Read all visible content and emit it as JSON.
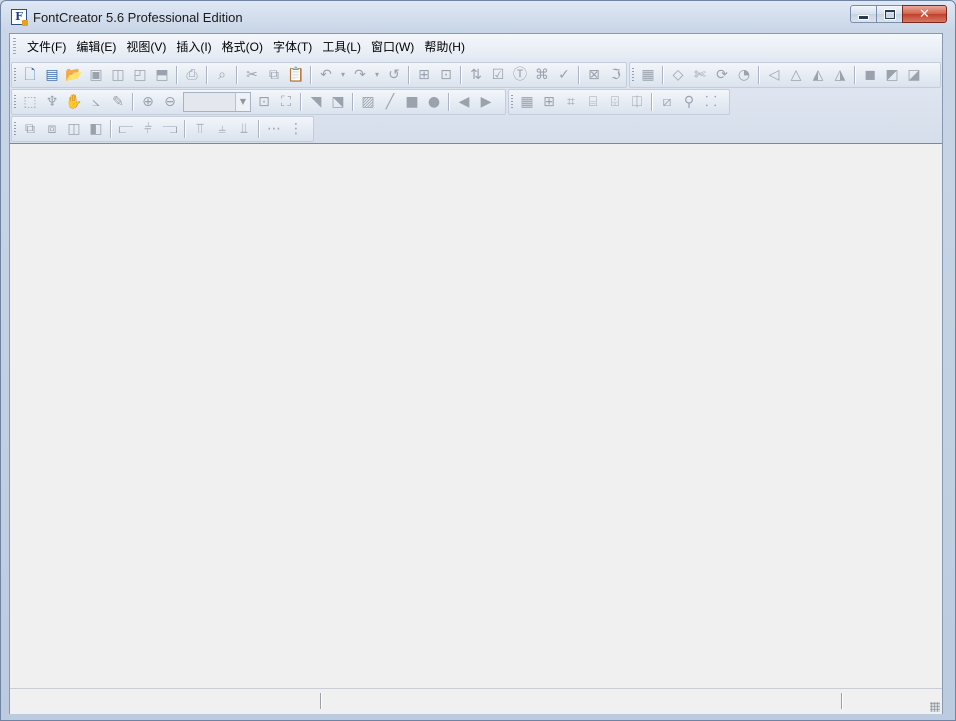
{
  "window": {
    "title": "FontCreator 5.6 Professional Edition",
    "app_icon_letter": "F",
    "close_glyph": "✕"
  },
  "menu": {
    "items": [
      {
        "label": "文件(F)",
        "name": "menu-file"
      },
      {
        "label": "编辑(E)",
        "name": "menu-edit"
      },
      {
        "label": "视图(V)",
        "name": "menu-view"
      },
      {
        "label": "插入(I)",
        "name": "menu-insert"
      },
      {
        "label": "格式(O)",
        "name": "menu-format"
      },
      {
        "label": "字体(T)",
        "name": "menu-font"
      },
      {
        "label": "工具(L)",
        "name": "menu-tools"
      },
      {
        "label": "窗口(W)",
        "name": "menu-window"
      },
      {
        "label": "帮助(H)",
        "name": "menu-help"
      }
    ]
  },
  "toolbar": {
    "zoom_value": "",
    "row1a": [
      {
        "icon": "new-file-icon",
        "glyph": "🗋",
        "active": true
      },
      {
        "icon": "new-from-template-icon",
        "glyph": "▤",
        "active": true
      },
      {
        "icon": "open-folder-icon",
        "glyph": "📂",
        "active": true,
        "folder": true
      },
      {
        "icon": "save-icon",
        "glyph": "▣"
      },
      {
        "icon": "save-all-icon",
        "glyph": "◫"
      },
      {
        "icon": "save-copy-icon",
        "glyph": "◰"
      },
      {
        "icon": "export-icon",
        "glyph": "⬒"
      },
      {
        "sep": true
      },
      {
        "icon": "print-icon",
        "glyph": "⎙"
      },
      {
        "sep": true
      },
      {
        "icon": "find-icon",
        "glyph": "⌕"
      },
      {
        "sep": true
      },
      {
        "icon": "cut-icon",
        "glyph": "✂"
      },
      {
        "icon": "copy-icon",
        "glyph": "⧉"
      },
      {
        "icon": "paste-icon",
        "glyph": "📋"
      },
      {
        "sep": true
      },
      {
        "icon": "undo-icon",
        "glyph": "↶"
      },
      {
        "icon": "undo-dropdown-icon",
        "glyph": "▾",
        "dd": true
      },
      {
        "icon": "redo-icon",
        "glyph": "↷"
      },
      {
        "icon": "redo-dropdown-icon",
        "glyph": "▾",
        "dd": true
      },
      {
        "icon": "revert-icon",
        "glyph": "↺"
      },
      {
        "sep": true
      },
      {
        "icon": "insert-glyph-icon",
        "glyph": "⊞"
      },
      {
        "icon": "insert-character-icon",
        "glyph": "⊡"
      },
      {
        "sep": true
      },
      {
        "icon": "sort-icon",
        "glyph": "⇅"
      },
      {
        "icon": "validate-icon",
        "glyph": "☑"
      },
      {
        "icon": "text-icon",
        "glyph": "Ⓣ"
      },
      {
        "icon": "tag-icon",
        "glyph": "⌘"
      },
      {
        "icon": "check-icon",
        "glyph": "✓"
      },
      {
        "sep": true
      },
      {
        "icon": "test-font-icon",
        "glyph": "⊠"
      },
      {
        "icon": "font-properties-icon",
        "glyph": "ℑ"
      }
    ],
    "row1b": [
      {
        "icon": "glyph-properties-icon",
        "glyph": "▦"
      },
      {
        "sep": true
      },
      {
        "icon": "eraser-icon",
        "glyph": "◇"
      },
      {
        "icon": "scissors-icon",
        "glyph": "✄"
      },
      {
        "icon": "rotate-icon",
        "glyph": "⟳"
      },
      {
        "icon": "clock-icon",
        "glyph": "◔"
      },
      {
        "sep": true
      },
      {
        "icon": "flip-horizontal-icon",
        "glyph": "◁"
      },
      {
        "icon": "mirror-icon",
        "glyph": "△"
      },
      {
        "icon": "skew-left-icon",
        "glyph": "◭"
      },
      {
        "icon": "skew-right-icon",
        "glyph": "◮"
      },
      {
        "sep": true
      },
      {
        "icon": "union-icon",
        "glyph": "◼"
      },
      {
        "icon": "intersect-icon",
        "glyph": "◩"
      },
      {
        "icon": "subtract-icon",
        "glyph": "◪"
      }
    ],
    "row2a": [
      {
        "icon": "rect-select-icon",
        "glyph": "⬚"
      },
      {
        "icon": "lasso-icon",
        "glyph": "♆"
      },
      {
        "icon": "hand-pan-icon",
        "glyph": "✋"
      },
      {
        "icon": "measure-icon",
        "glyph": "⦣"
      },
      {
        "icon": "pen-icon",
        "glyph": "✎"
      },
      {
        "sep": true
      },
      {
        "icon": "zoom-in-icon",
        "glyph": "⊕"
      },
      {
        "icon": "zoom-out-icon",
        "glyph": "⊖"
      },
      {
        "zoom": true
      },
      {
        "icon": "zoom-to-fit-icon",
        "glyph": "⊡"
      },
      {
        "icon": "zoom-selection-icon",
        "glyph": "⛶"
      },
      {
        "sep": true
      },
      {
        "icon": "reference-line-icon",
        "glyph": "◥"
      },
      {
        "icon": "select-node-icon",
        "glyph": "⬔"
      },
      {
        "sep": true
      },
      {
        "icon": "image-icon",
        "glyph": "▨"
      },
      {
        "icon": "line-icon",
        "glyph": "╱"
      },
      {
        "icon": "rectangle-icon",
        "glyph": "■"
      },
      {
        "icon": "ellipse-icon",
        "glyph": "●"
      },
      {
        "sep": true
      },
      {
        "icon": "previous-glyph-icon",
        "glyph": "◀"
      },
      {
        "icon": "next-glyph-icon",
        "glyph": "▶"
      }
    ],
    "row2b": [
      {
        "icon": "grid-icon",
        "glyph": "▦"
      },
      {
        "icon": "grid-align-icon",
        "glyph": "⊞"
      },
      {
        "icon": "bounds-icon",
        "glyph": "⌗"
      },
      {
        "icon": "bounds-dashed-icon",
        "glyph": "⌸"
      },
      {
        "icon": "metrics-icon",
        "glyph": "⌹"
      },
      {
        "icon": "baseline-icon",
        "glyph": "⎅"
      },
      {
        "sep": true
      },
      {
        "icon": "transform-icon",
        "glyph": "⧄"
      },
      {
        "icon": "node-tree-icon",
        "glyph": "⚲"
      },
      {
        "icon": "hinting-icon",
        "glyph": "⸬"
      }
    ],
    "row3": [
      {
        "icon": "bring-front-icon",
        "glyph": "⧉"
      },
      {
        "icon": "send-back-icon",
        "glyph": "⧈"
      },
      {
        "icon": "bring-forward-icon",
        "glyph": "◫"
      },
      {
        "icon": "send-backward-icon",
        "glyph": "◧"
      },
      {
        "sep": true
      },
      {
        "icon": "align-left-icon",
        "glyph": "⫍"
      },
      {
        "icon": "align-center-icon",
        "glyph": "⫩"
      },
      {
        "icon": "align-right-icon",
        "glyph": "⫎"
      },
      {
        "sep": true
      },
      {
        "icon": "align-top-icon",
        "glyph": "⫪"
      },
      {
        "icon": "align-middle-icon",
        "glyph": "⫨"
      },
      {
        "icon": "align-bottom-icon",
        "glyph": "⫫"
      },
      {
        "sep": true
      },
      {
        "icon": "distribute-horizontal-icon",
        "glyph": "⋯"
      },
      {
        "icon": "distribute-vertical-icon",
        "glyph": "⋮"
      }
    ]
  },
  "statusbar": {
    "panels": [
      "",
      "",
      ""
    ]
  }
}
